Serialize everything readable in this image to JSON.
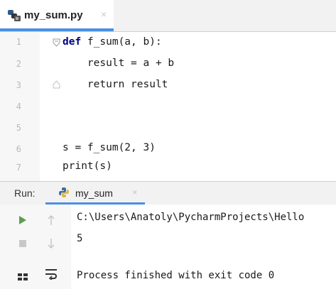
{
  "editor_tab": {
    "file_name": "my_sum.py",
    "close_glyph": "×"
  },
  "editor": {
    "line_numbers": [
      "1",
      "2",
      "3",
      "4",
      "5",
      "6",
      "7"
    ],
    "lines": [
      "def f_sum(a, b):",
      "    result = a + b",
      "    return result",
      "",
      "",
      "s = f_sum(2, 3)",
      "print(s)"
    ],
    "keyword_color": "#000080"
  },
  "run_panel": {
    "label": "Run:",
    "tab_label": "my_sum",
    "close_glyph": "×",
    "console": [
      "C:\\Users\\Anatoly\\PycharmProjects\\Hello",
      "5",
      "",
      "Process finished with exit code 0"
    ]
  },
  "colors": {
    "accent": "#4a90e2",
    "run_green": "#5b9e4d"
  }
}
